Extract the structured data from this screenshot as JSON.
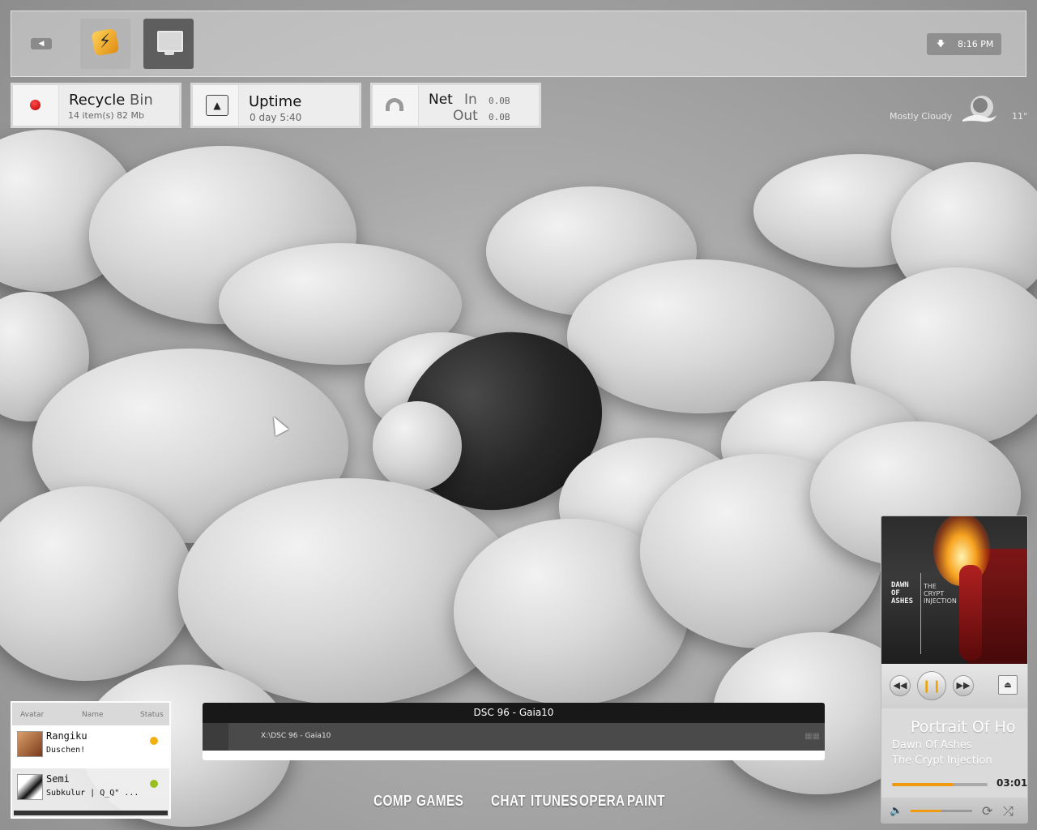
{
  "topbar": {
    "clock": "8:16 PM",
    "launchers": [
      {
        "icon": "winamp-icon"
      },
      {
        "icon": "computer-icon"
      }
    ]
  },
  "widgets": {
    "recycle": {
      "title_a": "Recycle",
      "title_b": "Bin",
      "items": "14 item(s)",
      "size": "82 Mb"
    },
    "uptime": {
      "title": "Uptime",
      "value": "0 day 5:40"
    },
    "net": {
      "title": "Net",
      "in_label": "In",
      "out_label": "Out",
      "in_value": "0.0B",
      "out_value": "0.0B"
    }
  },
  "weather": {
    "condition": "Mostly Cloudy",
    "temp": "11°"
  },
  "contacts": {
    "headers": {
      "avatar": "Avatar",
      "name": "Name",
      "status": "Status"
    },
    "rows": [
      {
        "name": "Rangiku",
        "message": "Duschen!",
        "status_color": "#f0b010"
      },
      {
        "name": "Semi",
        "message": "Subkulur |  Q_Q\" ...",
        "status_color": "#99c020"
      }
    ]
  },
  "explorer": {
    "title": "DSC 96 - Gaia10",
    "path": "X:\\DSC 96 - Gaia10"
  },
  "launch_words": [
    "COMP",
    "GAMES",
    "CHAT",
    "ITUNES",
    "OPERA",
    "PAINT"
  ],
  "player": {
    "song": "Portrait Of Ho",
    "artist": "Dawn Of Ashes",
    "album": "The Crypt Injection",
    "time": "03:01",
    "progress": 0.64,
    "volume": 0.5,
    "art_band": "DAWN\nOF\nASHES",
    "art_album": "THE\nCRYPT\nINJECTION",
    "accent": "#f09a10"
  }
}
